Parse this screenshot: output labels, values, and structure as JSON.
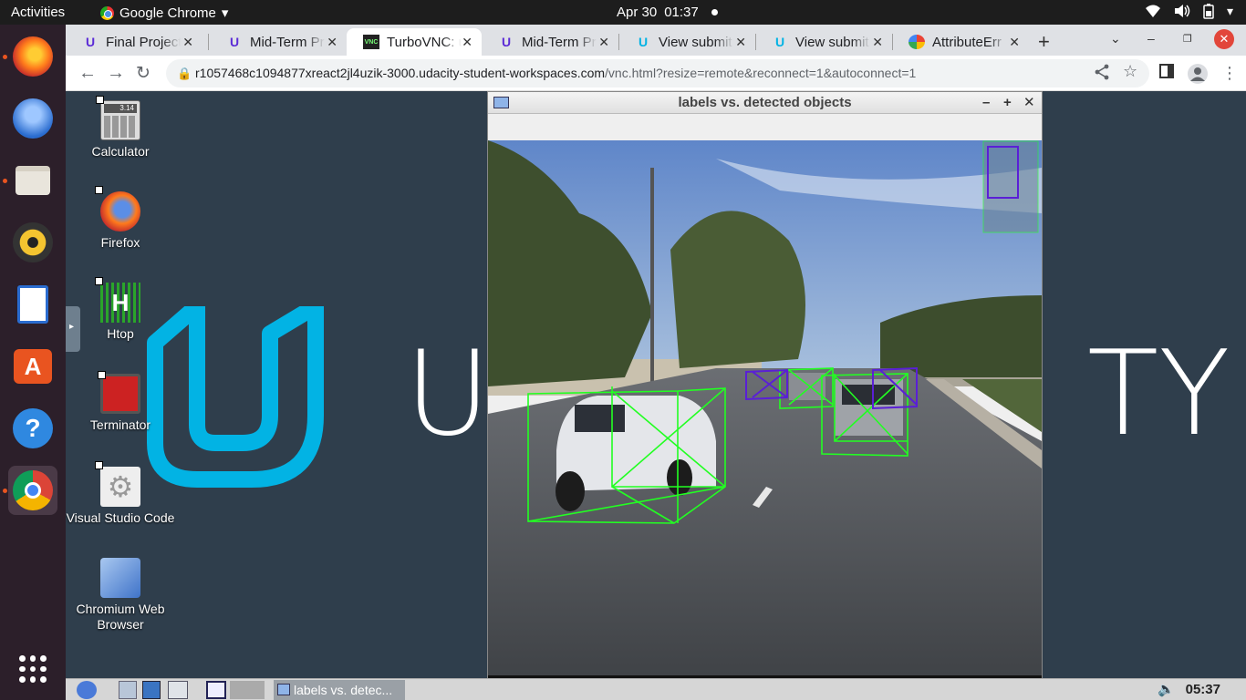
{
  "topbar": {
    "activities": "Activities",
    "app_name": "Google Chrome",
    "date": "Apr 30",
    "time": "01:37"
  },
  "dock": [
    {
      "name": "firefox",
      "icon": "firefox-icon",
      "running": true
    },
    {
      "name": "thunderbird",
      "icon": "mail-icon",
      "running": false
    },
    {
      "name": "files",
      "icon": "folder-icon",
      "running": true
    },
    {
      "name": "rhythmbox",
      "icon": "music-icon",
      "running": false
    },
    {
      "name": "libreoffice-writer",
      "icon": "document-icon",
      "running": false
    },
    {
      "name": "software",
      "icon": "store-icon",
      "running": false
    },
    {
      "name": "help",
      "icon": "help-icon",
      "running": false
    },
    {
      "name": "chrome",
      "icon": "chrome-icon",
      "running": true
    },
    {
      "name": "apps",
      "icon": "grid-icon",
      "running": false
    }
  ],
  "browser": {
    "tabs": [
      {
        "title": "Final Project",
        "icon": "udacity"
      },
      {
        "title": "Mid-Term Pr",
        "icon": "udacity"
      },
      {
        "title": "TurboVNC: u",
        "icon": "vnc",
        "active": true
      },
      {
        "title": "Mid-Term Pr",
        "icon": "udacity"
      },
      {
        "title": "View submit",
        "icon": "udacity-u"
      },
      {
        "title": "View submit",
        "icon": "udacity-u"
      },
      {
        "title": "AttributeErr",
        "icon": "google"
      }
    ],
    "url_host": "r1057468c1094877xreact2jl4uzik-3000.udacity-student-workspaces.com",
    "url_path": "/vnc.html?resize=remote&reconnect=1&autoconnect=1"
  },
  "desktop": {
    "wordmark_left": "U",
    "wordmark_right": "TY",
    "icons": [
      {
        "label": "Calculator",
        "icon": "calculator-icon"
      },
      {
        "label": "Firefox",
        "icon": "firefox-icon"
      },
      {
        "label": "Htop",
        "icon": "htop-icon"
      },
      {
        "label": "Terminator",
        "icon": "terminal-icon"
      },
      {
        "label": "Visual Studio Code",
        "icon": "gear-icon"
      },
      {
        "label": "Chromium Web Browser",
        "icon": "chromium-icon"
      }
    ],
    "calc_display": "3.14"
  },
  "xwindow": {
    "title": "labels vs. detected objects"
  },
  "taskbar": {
    "task_label": "labels vs. detec...",
    "clock": "05:37"
  },
  "colors": {
    "label_box": "#22ff22",
    "detection_box": "#5a1fd6",
    "udacity_blue": "#02b3e4"
  }
}
